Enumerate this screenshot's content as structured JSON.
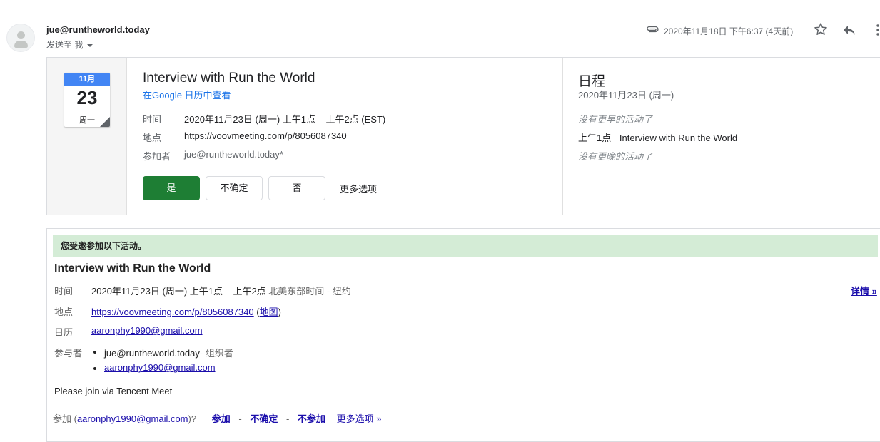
{
  "header": {
    "sender": "jue@runtheworld.today",
    "send_to_label": "发送至 我",
    "datetime": "2020年11月18日 下午6:37 (4天前)"
  },
  "card": {
    "calendar_icon": {
      "month": "11月",
      "day": "23",
      "weekday": "周一"
    },
    "title": "Interview with Run the World",
    "google_calendar_link": "在Google 日历中查看",
    "rows": [
      {
        "label": "时间",
        "value": "2020年11月23日 (周一) 上午1点 – 上午2点 (EST)"
      },
      {
        "label": "地点",
        "value": "https://voovmeeting.com/p/8056087340"
      },
      {
        "label": "参加者",
        "value": "jue@runtheworld.today*"
      }
    ],
    "buttons": {
      "yes": "是",
      "maybe": "不确定",
      "no": "否",
      "more": "更多选项"
    },
    "schedule": {
      "title": "日程",
      "date": "2020年11月23日 (周一)",
      "no_earlier": "没有更早的活动了",
      "event_time": "上午1点",
      "event_title": "Interview with Run the World",
      "no_later": "没有更晚的活动了"
    }
  },
  "invite": {
    "banner": "您受邀参加以下活动。",
    "title": "Interview with Run the World",
    "details_link": "详情 »",
    "time_label": "时间",
    "time_value": "2020年11月23日 (周一) 上午1点 – 上午2点",
    "time_zone": "北美东部时间 - 纽约",
    "location_label": "地点",
    "location_url": "https://voovmeeting.com/p/8056087340",
    "map_link": "地图",
    "calendar_label": "日历",
    "calendar_value": "aaronphy1990@gmail.com",
    "attendees_label": "参与者",
    "attendees": [
      {
        "name": "jue@runtheworld.today",
        "role": "- 组织者"
      },
      {
        "name": "aaronphy1990@gmail.com",
        "role": ""
      }
    ],
    "note": "Please join via Tencent Meet",
    "rsvp": {
      "prefix": "参加 (",
      "email": "aaronphy1990@gmail.com",
      "suffix": ")?",
      "yes": "参加",
      "maybe": "不确定",
      "no": "不参加",
      "more": "更多选项 »",
      "sep": "-"
    }
  },
  "colors": {
    "accept_green": "#1e7e34",
    "banner_green": "#d4ecd6",
    "calendar_blue": "#4285f4",
    "link_blue": "#1a73e8"
  }
}
